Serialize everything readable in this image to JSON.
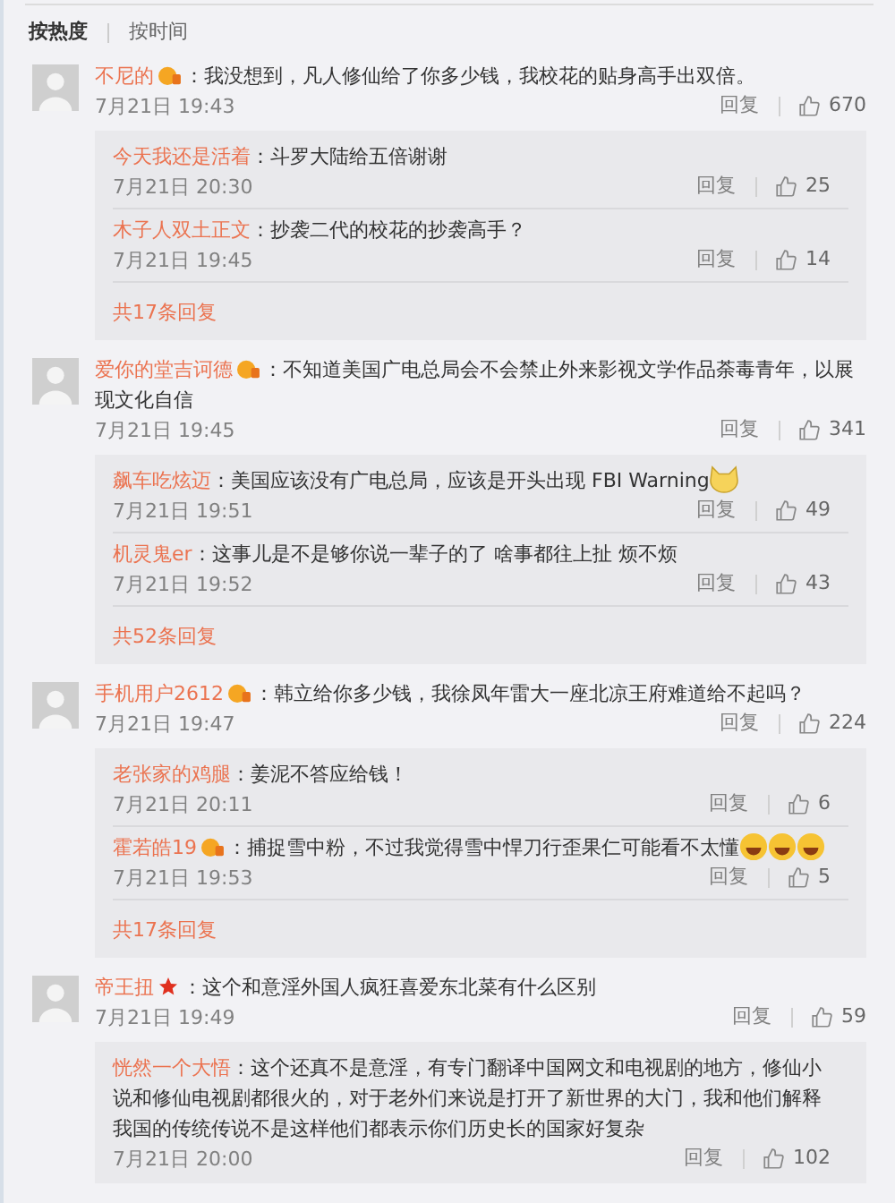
{
  "sort_tabs": [
    {
      "label": "按热度",
      "selected": true
    },
    {
      "label": "按时间",
      "selected": false
    }
  ],
  "comments": [
    {
      "user": "不尼的",
      "badge": {
        "kind": "vip"
      },
      "text": "：我没想到，凡人修仙给了你多少钱，我校花的贴身高手出双倍。",
      "time": "7月21日 19:43",
      "reply_label": "回复",
      "likes": "670",
      "replies": [
        {
          "user": "今天我还是活着",
          "text": "：斗罗大陆给五倍谢谢",
          "time": "7月21日 20:30",
          "reply_label": "回复",
          "likes": "25"
        },
        {
          "user": "木子人双土正文",
          "text": "：抄袭二代的校花的抄袭高手？",
          "time": "7月21日 19:45",
          "reply_label": "回复",
          "likes": "14"
        }
      ],
      "more": "共17条回复"
    },
    {
      "user": "爱你的堂吉诃德",
      "badge": {
        "kind": "vip"
      },
      "text": "：不知道美国广电总局会不会禁止外来影视文学作品荼毒青年，以展现文化自信",
      "time": "7月21日 19:45",
      "reply_label": "回复",
      "likes": "341",
      "replies": [
        {
          "user": "飙车吃炫迈",
          "text": "：美国应该没有广电总局，应该是开头出现 FBI Warning",
          "emojis": [
            {
              "kind": "cat"
            }
          ],
          "time": "7月21日 19:51",
          "reply_label": "回复",
          "likes": "49"
        },
        {
          "user": "机灵鬼er",
          "text": "：这事儿是不是够你说一辈子的了 啥事都往上扯 烦不烦",
          "time": "7月21日 19:52",
          "reply_label": "回复",
          "likes": "43"
        }
      ],
      "more": "共52条回复"
    },
    {
      "user": "手机用户2612",
      "badge": {
        "kind": "vip"
      },
      "text": "：韩立给你多少钱，我徐凤年雷大一座北凉王府难道给不起吗？",
      "time": "7月21日 19:47",
      "reply_label": "回复",
      "likes": "224",
      "replies": [
        {
          "user": "老张家的鸡腿",
          "text": "：姜泥不答应给钱！",
          "time": "7月21日 20:11",
          "reply_label": "回复",
          "likes": "6"
        },
        {
          "user": "霍若皓19",
          "badge": {
            "kind": "vip"
          },
          "text": "：捕捉雪中粉，不过我觉得雪中悍刀行歪果仁可能看不太懂",
          "emojis": [
            {
              "kind": "laugh"
            },
            {
              "kind": "laugh"
            },
            {
              "kind": "laugh"
            }
          ],
          "time": "7月21日 19:53",
          "reply_label": "回复",
          "likes": "5"
        }
      ],
      "more": "共17条回复"
    },
    {
      "user": "帝王扭",
      "badge": {
        "kind": "star"
      },
      "text": "：这个和意淫外国人疯狂喜爱东北菜有什么区别",
      "time": "7月21日 19:49",
      "reply_label": "回复",
      "likes": "59",
      "replies": [
        {
          "user": "恍然一个大悟",
          "text": "：这个还真不是意淫，有专门翻译中国网文和电视剧的地方，修仙小说和修仙电视剧都很火的，对于老外们来说是打开了新世界的大门，我和他们解释我国的传统传说不是这样他们都表示你们历史长的国家好复杂",
          "time": "7月21日 20:00",
          "reply_label": "回复",
          "likes": "102"
        }
      ]
    }
  ]
}
